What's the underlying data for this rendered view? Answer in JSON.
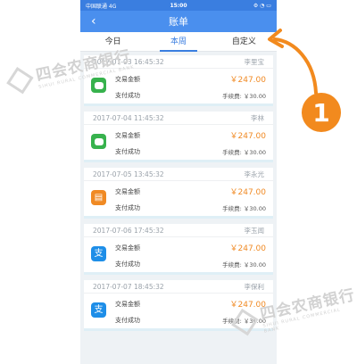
{
  "status_bar": {
    "carrier": "中国联通 4G",
    "time": "15:00",
    "battery": "⚙ ◔ ▭"
  },
  "nav": {
    "title": "账单",
    "back_icon": "chevron-left-icon"
  },
  "tabs": [
    {
      "label": "今日",
      "active": false
    },
    {
      "label": "本周",
      "active": true
    },
    {
      "label": "自定义",
      "active": false
    }
  ],
  "transactions": [
    {
      "datetime": "2017-07-03 16:45:32",
      "person": "李里宝",
      "pay_type": "wechat",
      "label": "交易金额",
      "amount": "￥247.00",
      "status": "支付成功",
      "fee": "手续费: ￥30.00"
    },
    {
      "datetime": "2017-07-04 11:45:32",
      "person": "李林",
      "pay_type": "wechat",
      "label": "交易金额",
      "amount": "￥247.00",
      "status": "支付成功",
      "fee": "手续费: ￥30.00"
    },
    {
      "datetime": "2017-07-05 13:45:32",
      "person": "李永光",
      "pay_type": "bank",
      "label": "交易金额",
      "amount": "￥247.00",
      "status": "支付成功",
      "fee": "手续费: ￥30.00"
    },
    {
      "datetime": "2017-07-06 17:45:32",
      "person": "李玉闻",
      "pay_type": "alipay",
      "label": "交易金额",
      "amount": "￥247.00",
      "status": "支付成功",
      "fee": "手续费: ￥30.00"
    },
    {
      "datetime": "2017-07-07 18:45:32",
      "person": "李保利",
      "pay_type": "alipay",
      "label": "交易金额",
      "amount": "￥247.00",
      "status": "支付成功",
      "fee": "手续费: ￥30.00"
    }
  ],
  "watermark": {
    "cn": "四会农商银行",
    "en": "SIHUI RURAL COMMERCIAL BANK"
  },
  "annotation": {
    "number": "1",
    "color": "#f28a1e"
  },
  "colors": {
    "primary": "#4a8fee",
    "amount": "#f08a24",
    "wechat": "#37b24d",
    "alipay": "#1e8ee8",
    "bank": "#f08a24"
  }
}
